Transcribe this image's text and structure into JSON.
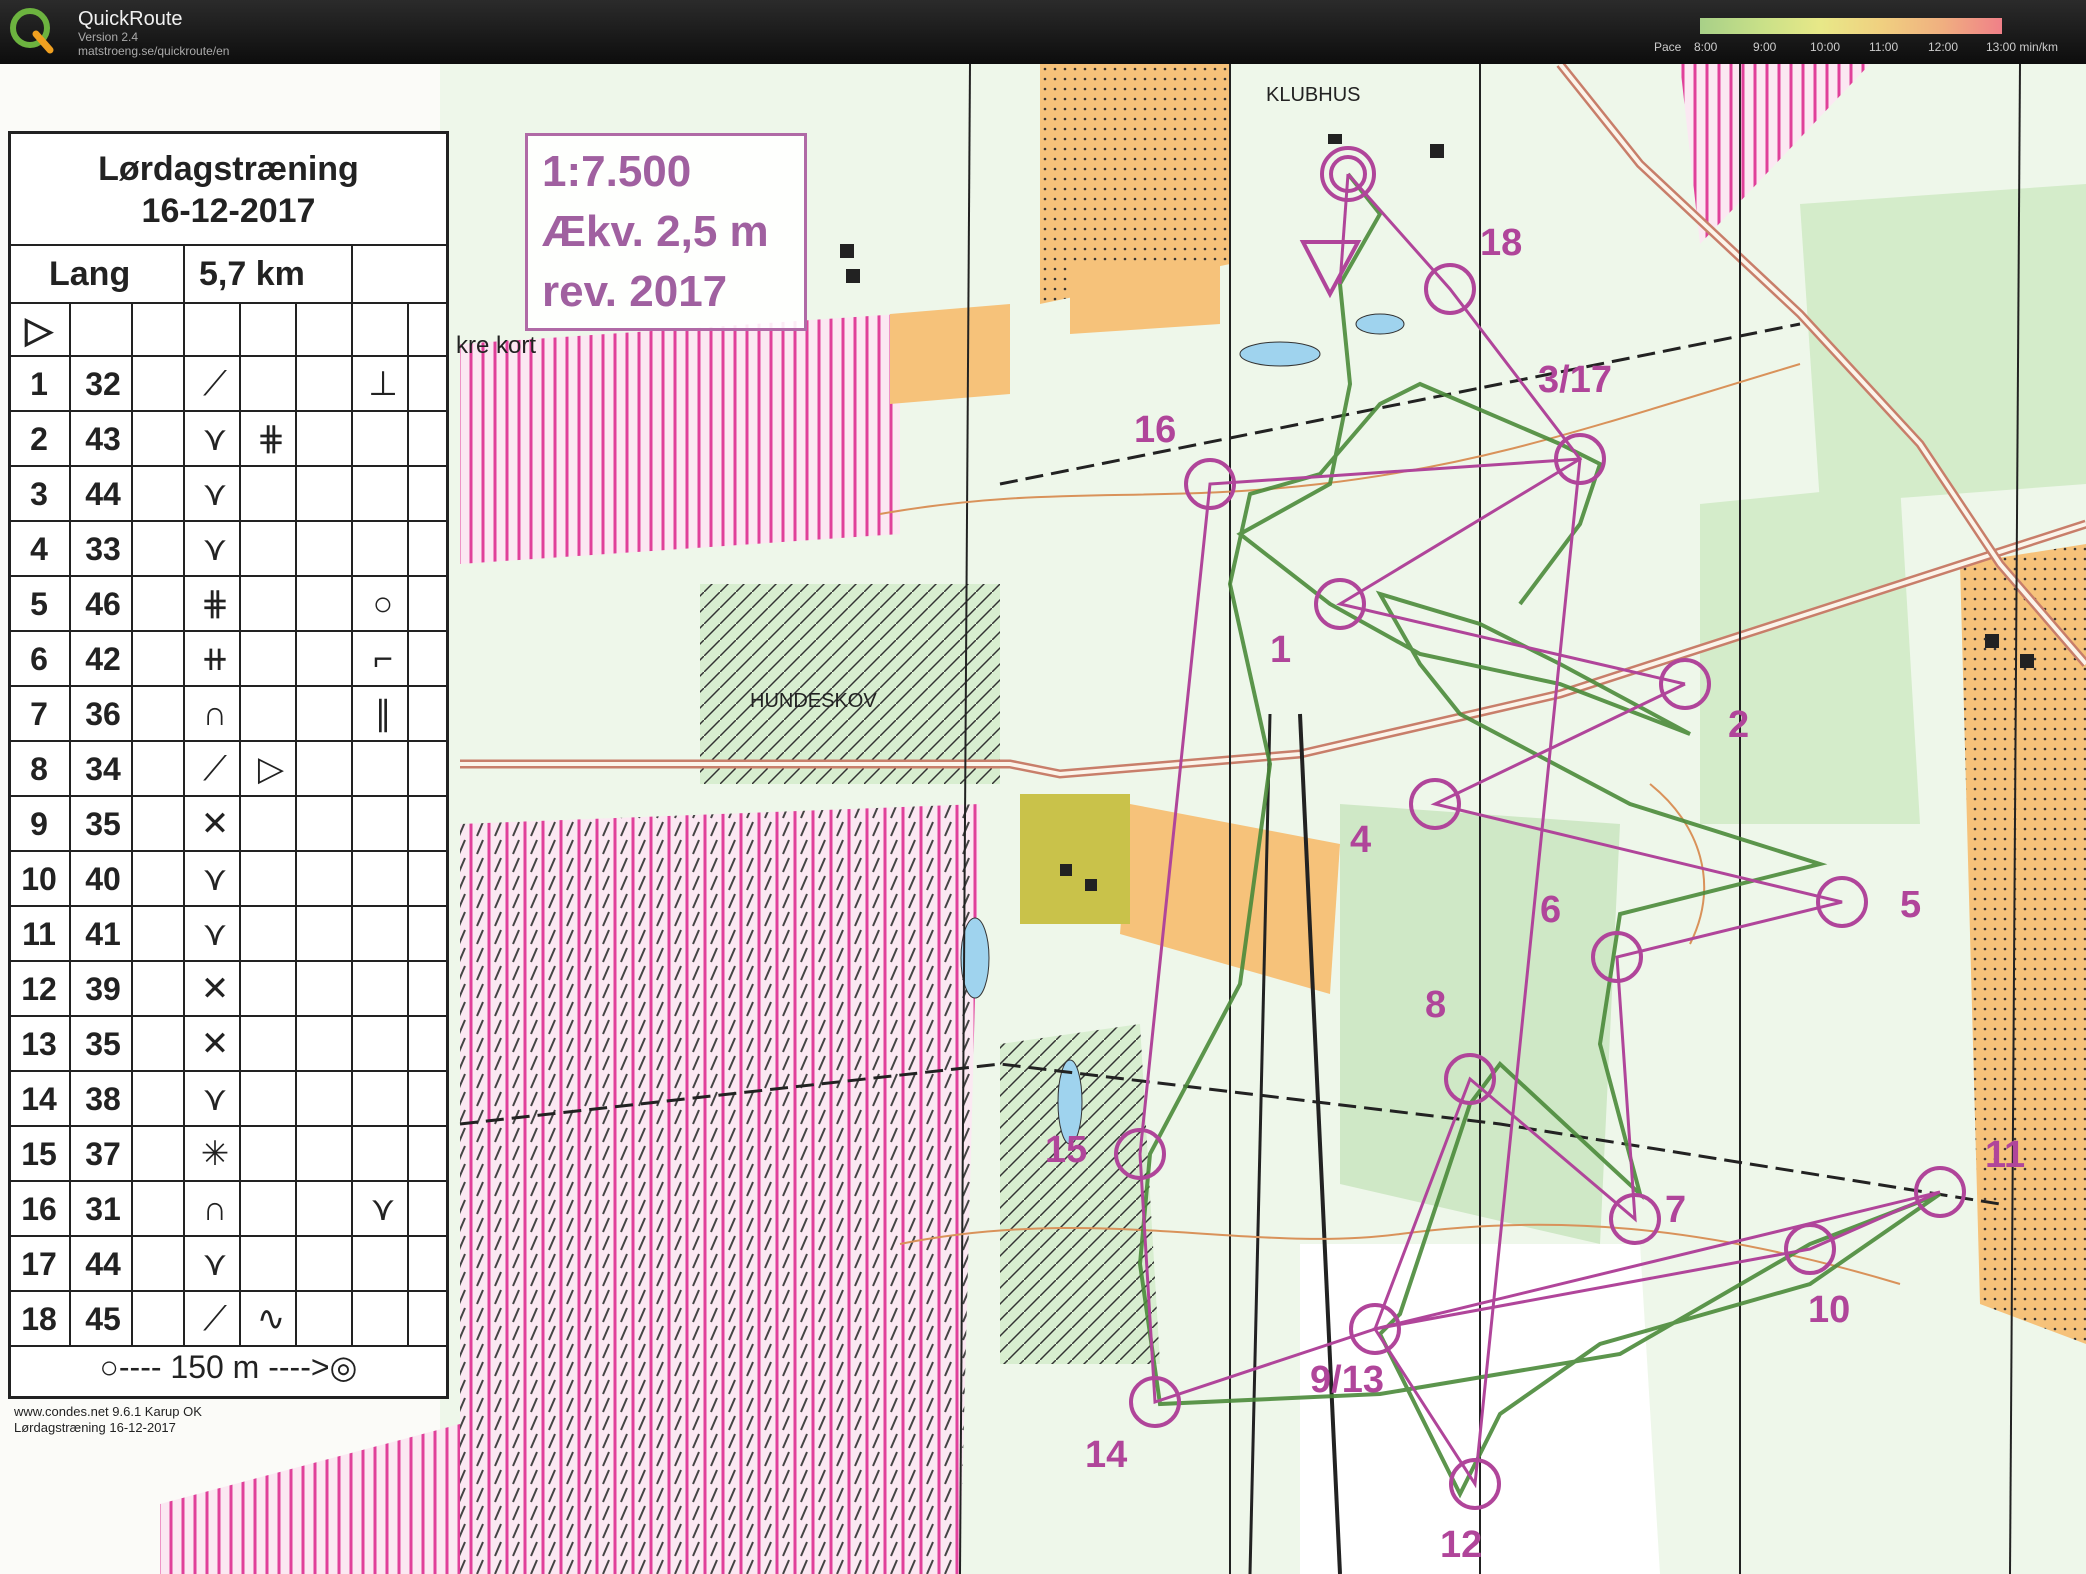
{
  "app": {
    "name": "QuickRoute",
    "version": "Version 2.4",
    "url": "matstroeng.se/quickroute/en"
  },
  "pace_legend": {
    "label": "Pace",
    "ticks": [
      "8:00",
      "9:00",
      "10:00",
      "11:00",
      "12:00",
      "13:00 min/km"
    ],
    "colors": [
      "#a8d088",
      "#c8e088",
      "#e8e888",
      "#f0d080",
      "#f0b080",
      "#f08088"
    ]
  },
  "description_sheet": {
    "title_line1": "Lørdagstræning",
    "title_line2": "16-12-2017",
    "course": "Lang",
    "distance": "5,7 km",
    "start_symbol": "▷",
    "rows": [
      {
        "num": "1",
        "code": "32",
        "c": "⟋",
        "d": "",
        "g": "⊥"
      },
      {
        "num": "2",
        "code": "43",
        "c": "⋎",
        "d": "⋕",
        "g": ""
      },
      {
        "num": "3",
        "code": "44",
        "c": "⋎",
        "d": "",
        "g": ""
      },
      {
        "num": "4",
        "code": "33",
        "c": "⋎",
        "d": "",
        "g": ""
      },
      {
        "num": "5",
        "code": "46",
        "c": "⋕",
        "d": "",
        "g": "○"
      },
      {
        "num": "6",
        "code": "42",
        "c": "⧺",
        "d": "",
        "g": "⌐"
      },
      {
        "num": "7",
        "code": "36",
        "c": "∩",
        "d": "",
        "g": "∥"
      },
      {
        "num": "8",
        "code": "34",
        "c": "⟋",
        "d": "▷",
        "g": ""
      },
      {
        "num": "9",
        "code": "35",
        "c": "✕",
        "d": "",
        "g": ""
      },
      {
        "num": "10",
        "code": "40",
        "c": "⋎",
        "d": "",
        "g": ""
      },
      {
        "num": "11",
        "code": "41",
        "c": "⋎",
        "d": "",
        "g": ""
      },
      {
        "num": "12",
        "code": "39",
        "c": "✕",
        "d": "",
        "g": ""
      },
      {
        "num": "13",
        "code": "35",
        "c": "✕",
        "d": "",
        "g": ""
      },
      {
        "num": "14",
        "code": "38",
        "c": "⋎",
        "d": "",
        "g": ""
      },
      {
        "num": "15",
        "code": "37",
        "c": "✳",
        "d": "",
        "g": ""
      },
      {
        "num": "16",
        "code": "31",
        "c": "∩",
        "d": "",
        "g": "⋎"
      },
      {
        "num": "17",
        "code": "44",
        "c": "⋎",
        "d": "",
        "g": ""
      },
      {
        "num": "18",
        "code": "45",
        "c": "⟋",
        "d": "∿",
        "g": ""
      }
    ],
    "finish_note": "○---- 150 m ---->◎"
  },
  "scale_box": {
    "line1": "1:7.500",
    "line2": "Ækv. 2,5 m",
    "line3": "rev. 2017"
  },
  "map_labels": {
    "klubhus": "KLUBHUS",
    "hundeskov": "HUNDESKOV",
    "kre_kort": "kre kort"
  },
  "credit": {
    "line1": "www.condes.net 9.6.1 Karup OK",
    "line2": "Lørdagstræning 16-12-2017"
  },
  "control_labels": [
    "18",
    "3/17",
    "16",
    "1",
    "2",
    "4",
    "5",
    "6",
    "8",
    "15",
    "7",
    "11",
    "10",
    "9/13",
    "14",
    "12"
  ],
  "colors": {
    "course": "#b0459a",
    "route": "#4a8a3a",
    "forest": "#c8e6c0",
    "open": "#f3b060",
    "restricted": "#e0409a"
  }
}
